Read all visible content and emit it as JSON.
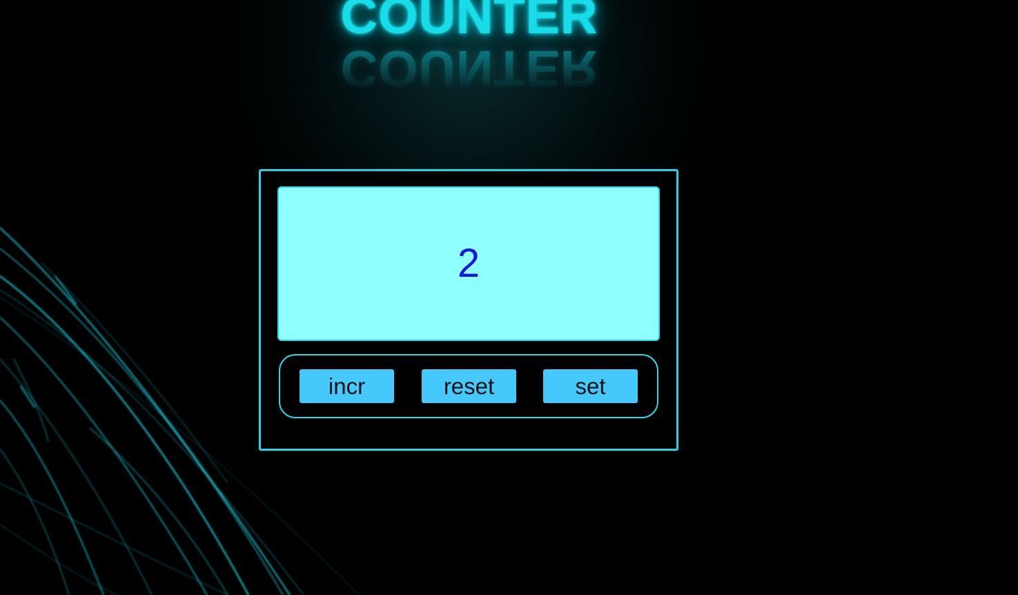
{
  "app": {
    "title": "COUNTER",
    "accent_color": "#1fd6e6",
    "display_bg_color": "#8fffff",
    "value_color": "#1414e6",
    "button_color": "#45c8fb"
  },
  "counter": {
    "value": "2"
  },
  "controls": {
    "incr_label": "incr",
    "reset_label": "reset",
    "set_label": "set"
  }
}
